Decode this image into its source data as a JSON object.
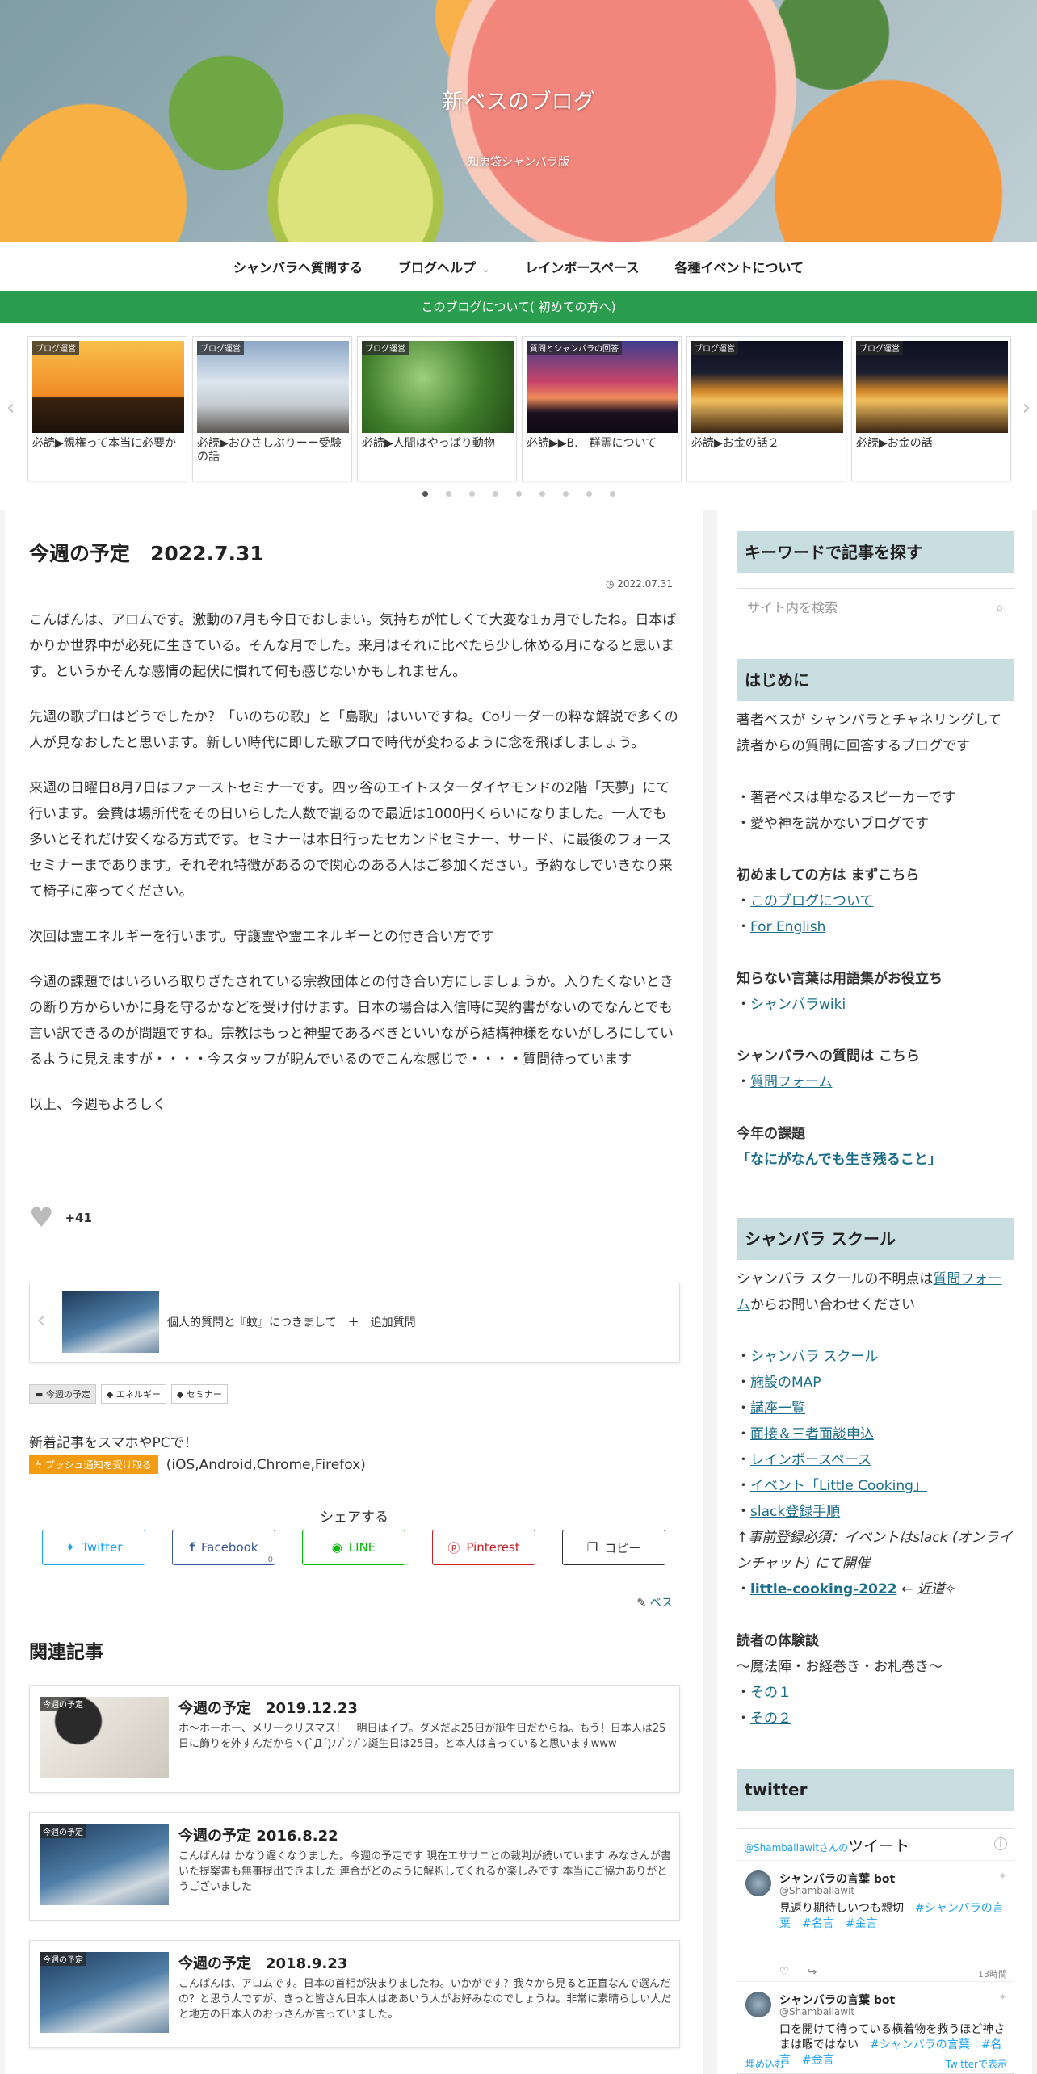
{
  "site": {
    "title": "新ベスのブログ",
    "subtitle": "知恵袋シャンバラ版"
  },
  "nav": {
    "items": [
      "シャンバラへ質問する",
      "ブログヘルプ",
      "レインボースペース",
      "各種イベントについて"
    ]
  },
  "notice": "このブログについて( 初めての方へ)",
  "carousel": {
    "cards": [
      {
        "label": "ブログ運営",
        "title": "必読▶親権って本当に必要か"
      },
      {
        "label": "ブログ運営",
        "title": "必読▶おひさしぶりーー受験の話"
      },
      {
        "label": "ブログ運営",
        "title": "必読▶人間はやっぱり動物"
      },
      {
        "label": "質問とシャンバラの回答",
        "title": "必読▶▶B.　群霊について"
      },
      {
        "label": "ブログ運営",
        "title": "必読▶お金の話２"
      },
      {
        "label": "ブログ運営",
        "title": "必読▶お金の話"
      }
    ],
    "dot_count": 9,
    "active_dot": 0
  },
  "post": {
    "title": "今週の予定　2022.7.31",
    "date": "2022.07.31",
    "paragraphs": [
      "こんばんは、アロムです。激動の7月も今日でおしまい。気持ちが忙しくて大変な1ヵ月でしたね。日本ばかりか世界中が必死に生きている。そんな月でした。来月はそれに比べたら少し休める月になると思います。というかそんな感情の起伏に慣れて何も感じないかもしれません。",
      "先週の歌プロはどうでしたか？「いのちの歌」と「島歌」はいいですね。Coリーダーの粋な解説で多くの人が見なおしたと思います。新しい時代に即した歌プロで時代が変わるように念を飛ばしましょう。",
      "来週の日曜日8月7日はファーストセミナーです。四ッ谷のエイトスターダイヤモンドの2階「天夢」にて行います。会費は場所代をその日いらした人数で割るので最近は1000円くらいになりました。一人でも多いとそれだけ安くなる方式です。セミナーは本日行ったセカンドセミナー、サード、に最後のフォースセミナーまであります。それぞれ特徴があるので関心のある人はご参加ください。予約なしでいきなり来て椅子に座ってください。",
      "次回は霊エネルギーを行います。守護霊や霊エネルギーとの付き合い方です",
      "今週の課題ではいろいろ取りざたされている宗教団体との付き合い方にしましょうか。入りたくないときの断り方からいかに身を守るかなどを受け付けます。日本の場合は入信時に契約書がないのでなんとでも言い訳できるのが問題ですね。宗教はもっと神聖であるべきといいながら結構神様をないがしろにしているように見えますが・・・・今スタッフが睨んでいるのでこんな感じで・・・・質問待っています",
      "以上、今週もよろしく"
    ],
    "likes": "+41",
    "prev_post": "個人的質問と『蚊』につきまして　＋　追加質問",
    "tags": [
      "今週の予定",
      "エネルギー",
      "セミナー"
    ],
    "push_title": "新着記事をスマホやPCで！",
    "push_button": "プッシュ通知を受け取る",
    "push_note": "(iOS,Android,Chrome,Firefox)",
    "share_heading": "シェアする",
    "share_buttons": [
      {
        "label": "Twitter",
        "icon": "twitter-icon",
        "color": "#1da1f2",
        "count": ""
      },
      {
        "label": "Facebook",
        "icon": "facebook-icon",
        "color": "#3b5998",
        "count": "0"
      },
      {
        "label": "LINE",
        "icon": "line-icon",
        "color": "#00b900",
        "count": ""
      },
      {
        "label": "Pinterest",
        "icon": "pinterest-icon",
        "color": "#cb2027",
        "count": ""
      },
      {
        "label": "コピー",
        "icon": "copy-icon",
        "color": "#333333",
        "count": ""
      }
    ],
    "author": "ベス"
  },
  "related": {
    "heading": "関連記事",
    "items": [
      {
        "label": "今週の予定",
        "title": "今週の予定　2019.12.23",
        "excerpt": "ホ〜ホーホー、メリークリスマス！　明日はイブ。ダメだよ25日が誕生日だからね。もう！日本人は25日に飾りを外すんだからヽ(`Д´)ﾉﾌﾟﾝﾌﾟﾝ誕生日は25日。と本人は言っていると思いますwww"
      },
      {
        "label": "今週の予定",
        "title": "今週の予定 2016.8.22",
        "excerpt": "こんばんは かなり遅くなりました。今週の予定です 現在エササニとの裁判が続いています みなさんが書いた提案書も無事提出できました 連合がどのように解釈してくれるか楽しみです 本当にご協力ありがとうございました"
      },
      {
        "label": "今週の予定",
        "title": "今週の予定　2018.9.23",
        "excerpt": "こんばんは、アロムです。日本の首相が決まりましたね。いかがです？我々から見ると正直なんで選んだの？と思う人ですが、きっと皆さん日本人はああいう人がお好みなのでしょうね。非常に素晴らしい人だと地方の日本人のおっさんが言っていました。"
      }
    ]
  },
  "sidebar": {
    "search_heading": "キーワードで記事を探す",
    "search_placeholder": "サイト内を検索",
    "intro_heading": "はじめに",
    "intro_text": "著者ベスが シャンバラとチャネリングして 読者からの質問に回答するブログです",
    "bullets": [
      "・著者ベスは単なるスピーカーです",
      "・愛や神を説かないブログです"
    ],
    "first_time_label": "初めましての方は まずこちら",
    "first_links": [
      "このブログについて",
      "For English"
    ],
    "glossary_label": "知らない言葉は用語集がお役立ち",
    "glossary_link": "シャンバラwiki",
    "question_label": "シャンバラへの質問は こちら",
    "question_link": "質問フォーム",
    "theme_label": "今年の課題",
    "theme_link": "「なにがなんでも生き残ること」",
    "school_heading": "シャンバラ スクール",
    "school_text_before": "シャンバラ スクールの不明点は",
    "school_text_link": "質問フォーム",
    "school_text_after": "からお問い合わせください",
    "school_links": [
      "シャンバラ スクール",
      "施設のMAP",
      "講座一覧",
      "面接＆三者面談申込",
      "レインボースペース",
      "イベント「Little Cooking」",
      "slack登録手順"
    ],
    "slack_note": "↑事前登録必須：イベントはslack (オンラインチャット) にて開催",
    "cooking_link": "little-cooking-2022",
    "cooking_note": "← 近道✧",
    "experience_label": "読者の体験談",
    "experience_sub": "〜魔法陣・お経巻き・お札巻き〜",
    "experience_links": [
      "その１",
      "その２"
    ],
    "twitter_heading": "twitter",
    "twitter_widget": {
      "account_prefix": "@Shamballawitさんの",
      "account_suffix": "ツイート",
      "tweets": [
        {
          "name": "シャンバラの言葉 bot",
          "handle": "@Shamballawit",
          "text": "見返り期待しいつも親切",
          "tags": "#シャンバラの言葉　#名言　#金言",
          "time": "13時間"
        },
        {
          "name": "シャンバラの言葉 bot",
          "handle": "@Shamballawit",
          "text": "口を開けて待っている横着物を救うほど神さまは暇ではない",
          "tags": "#シャンバラの言葉　#名言　#金言",
          "time": ""
        }
      ],
      "footer_left": "埋め込む",
      "footer_right": "Twitterで表示"
    }
  }
}
